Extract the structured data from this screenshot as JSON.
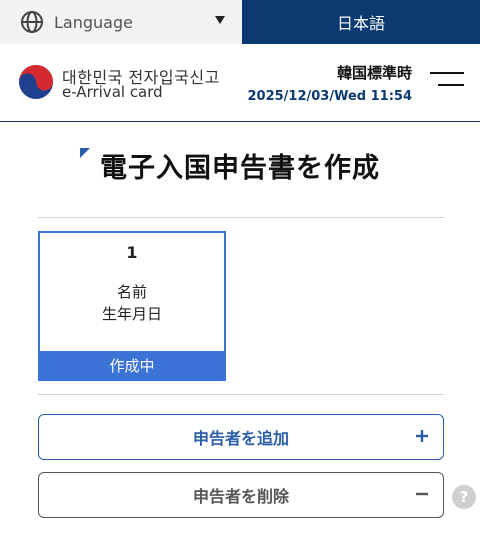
{
  "language_bar": {
    "label": "Language",
    "current": "日本語",
    "icons": {
      "globe": "globe-icon",
      "caret": "caret-down-icon"
    }
  },
  "header": {
    "brand_ko": "대한민국 전자입국신고",
    "brand_en": "e-Arrival card",
    "timezone_label": "韓国標準時",
    "datetime": "2025/12/03/Wed 11:54",
    "menu_icon": "menu-icon"
  },
  "main": {
    "title": "電子入国申告書を作成",
    "cards": [
      {
        "number": "1",
        "name": "名前",
        "dob": "生年月日",
        "status": "作成中"
      }
    ],
    "add_button": {
      "label": "申告者を追加",
      "icon": "plus-icon"
    },
    "delete_button": {
      "label": "申告者を削除",
      "icon": "minus-icon"
    },
    "help_glyph": "?"
  },
  "colors": {
    "navy": "#0b3a73",
    "accent_blue": "#3b73d6",
    "button_blue": "#2a5ea8",
    "gray_text": "#555555"
  }
}
